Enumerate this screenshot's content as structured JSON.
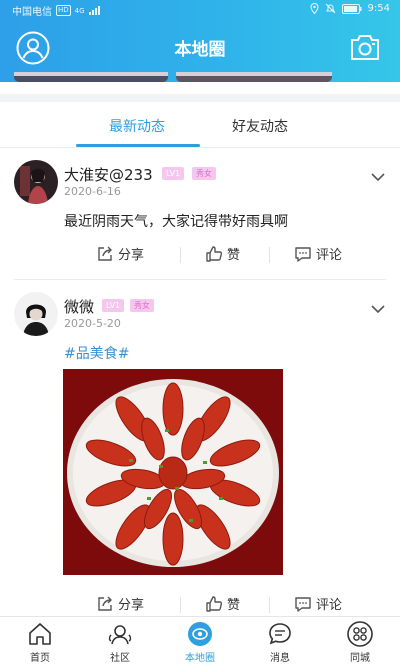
{
  "status_bar": {
    "carrier": "中国电信",
    "hd": "HD",
    "network": "4G",
    "time": "9:54"
  },
  "header": {
    "title": "本地圈",
    "gradient_start": "#2e9fe8",
    "gradient_end": "#35c6e9",
    "left_icon": "user-avatar-icon",
    "right_icon": "camera-icon"
  },
  "tabs": [
    {
      "label": "最新动态",
      "active": true
    },
    {
      "label": "好友动态",
      "active": false
    }
  ],
  "posts": [
    {
      "username": "大淮安@233",
      "level": "LV1",
      "gender_tag": "秀女",
      "date": "2020-6-16",
      "text": "最近阴雨天气，大家记得带好雨具啊",
      "actions": {
        "share": "分享",
        "like": "赞",
        "comment": "评论"
      }
    },
    {
      "username": "微微",
      "level": "LV1",
      "gender_tag": "秀女",
      "date": "2020-5-20",
      "hashtag": "#品美食#",
      "image": "crayfish-plate-photo",
      "actions": {
        "share": "分享",
        "like": "赞",
        "comment": "评论"
      }
    }
  ],
  "bottom_nav": [
    {
      "label": "首页",
      "icon": "home-icon",
      "active": false
    },
    {
      "label": "社区",
      "icon": "community-icon",
      "active": false
    },
    {
      "label": "本地圈",
      "icon": "local-circle-icon",
      "active": true
    },
    {
      "label": "消息",
      "icon": "message-icon",
      "active": false
    },
    {
      "label": "同城",
      "icon": "grid-icon",
      "active": false
    }
  ],
  "accent_color": "#2f9fdf"
}
